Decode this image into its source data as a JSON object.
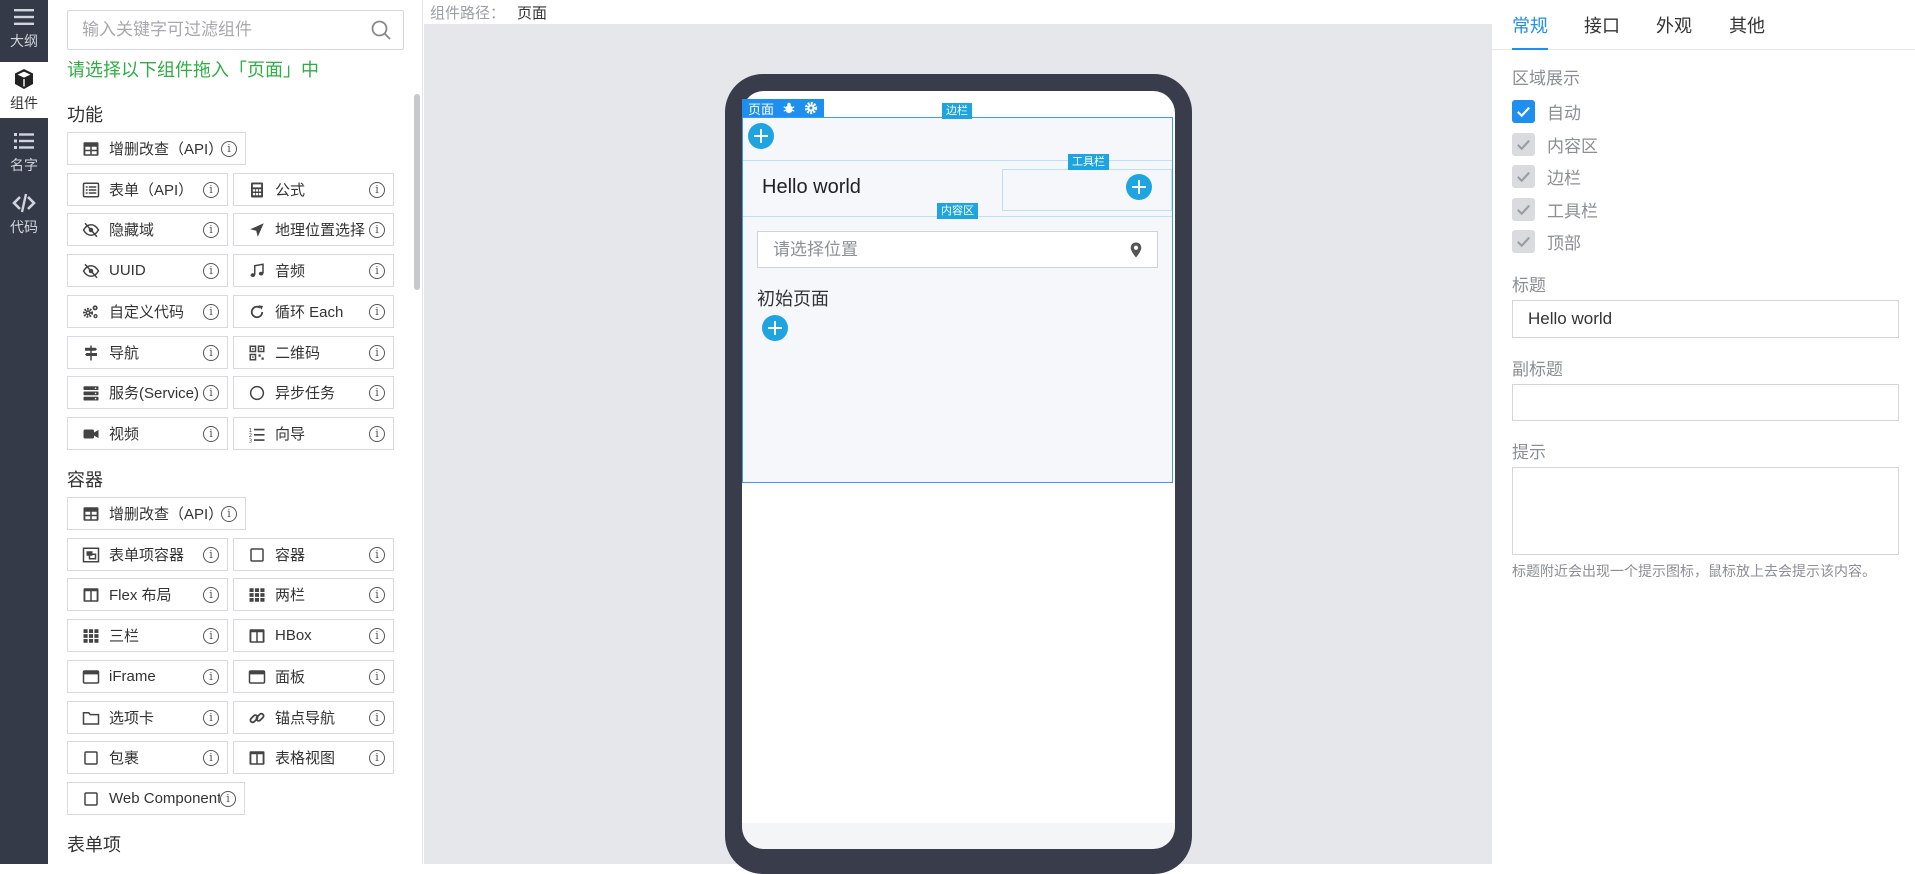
{
  "rail": [
    {
      "label": "大纲",
      "icon": "menu-icon",
      "active": false
    },
    {
      "label": "组件",
      "icon": "cube-icon",
      "active": true
    },
    {
      "label": "名字",
      "icon": "list-icon",
      "active": false
    },
    {
      "label": "代码",
      "icon": "code-icon",
      "active": false
    }
  ],
  "panel": {
    "search_placeholder": "输入关键字可过滤组件",
    "hint": "请选择以下组件拖入「页面」中",
    "sections": {
      "function_title": "功能",
      "container_title": "容器",
      "form_title": "表单项"
    },
    "function_items": [
      {
        "label": "增删改查（API）",
        "icon": "table-icon"
      },
      {
        "label": "表单（API）",
        "icon": "form-list-icon"
      },
      {
        "label": "公式",
        "icon": "calculator-icon"
      },
      {
        "label": "隐藏域",
        "icon": "eye-slash-icon"
      },
      {
        "label": "地理位置选择",
        "icon": "location-arrow-icon"
      },
      {
        "label": "UUID",
        "icon": "eye-slash-icon"
      },
      {
        "label": "音频",
        "icon": "music-icon"
      },
      {
        "label": "自定义代码",
        "icon": "cogs-icon"
      },
      {
        "label": "循环 Each",
        "icon": "repeat-icon"
      },
      {
        "label": "导航",
        "icon": "signs-icon"
      },
      {
        "label": "二维码",
        "icon": "qrcode-icon"
      },
      {
        "label": "服务(Service)",
        "icon": "server-icon"
      },
      {
        "label": "异步任务",
        "icon": "circle-icon"
      },
      {
        "label": "视频",
        "icon": "video-icon"
      },
      {
        "label": "向导",
        "icon": "ordered-list-icon"
      }
    ],
    "container_items": [
      {
        "label": "增删改查（API）",
        "icon": "table-icon"
      },
      {
        "label": "表单项容器",
        "icon": "object-group-icon"
      },
      {
        "label": "容器",
        "icon": "square-icon"
      },
      {
        "label": "Flex 布局",
        "icon": "columns-icon"
      },
      {
        "label": "两栏",
        "icon": "grid-icon"
      },
      {
        "label": "三栏",
        "icon": "grid-icon"
      },
      {
        "label": "HBox",
        "icon": "columns-icon"
      },
      {
        "label": "iFrame",
        "icon": "window-icon"
      },
      {
        "label": "面板",
        "icon": "window-icon"
      },
      {
        "label": "选项卡",
        "icon": "folder-icon"
      },
      {
        "label": "锚点导航",
        "icon": "link-icon"
      },
      {
        "label": "包裹",
        "icon": "square-icon"
      },
      {
        "label": "表格视图",
        "icon": "columns-icon"
      },
      {
        "label": "Web Component",
        "icon": "square-icon"
      }
    ]
  },
  "canvas": {
    "path_label": "组件路径：",
    "path_value": "页面",
    "page_tag": "页面",
    "aside_tag": "边栏",
    "toolbar_tag": "工具栏",
    "content_tag": "内容区",
    "title": "Hello world",
    "location_placeholder": "请选择位置",
    "initial_text": "初始页面"
  },
  "props": {
    "tabs": [
      "常规",
      "接口",
      "外观",
      "其他"
    ],
    "region_label": "区域展示",
    "regions": [
      {
        "label": "自动",
        "checked": true,
        "disabled": false
      },
      {
        "label": "内容区",
        "checked": true,
        "disabled": true
      },
      {
        "label": "边栏",
        "checked": true,
        "disabled": true
      },
      {
        "label": "工具栏",
        "checked": true,
        "disabled": true
      },
      {
        "label": "顶部",
        "checked": true,
        "disabled": true
      }
    ],
    "title_label": "标题",
    "title_value": "Hello world",
    "subtitle_label": "副标题",
    "subtitle_value": "",
    "remark_label": "提示",
    "remark_value": "",
    "remark_note": "标题附近会出现一个提示图标，鼠标放上去会提示该内容。"
  },
  "colors": {
    "accent": "#1e8fef",
    "hint_green": "#2eae43",
    "rail_bg": "#353a48",
    "phone_frame": "#383c4b",
    "plus_blue": "#1ea4e0"
  }
}
